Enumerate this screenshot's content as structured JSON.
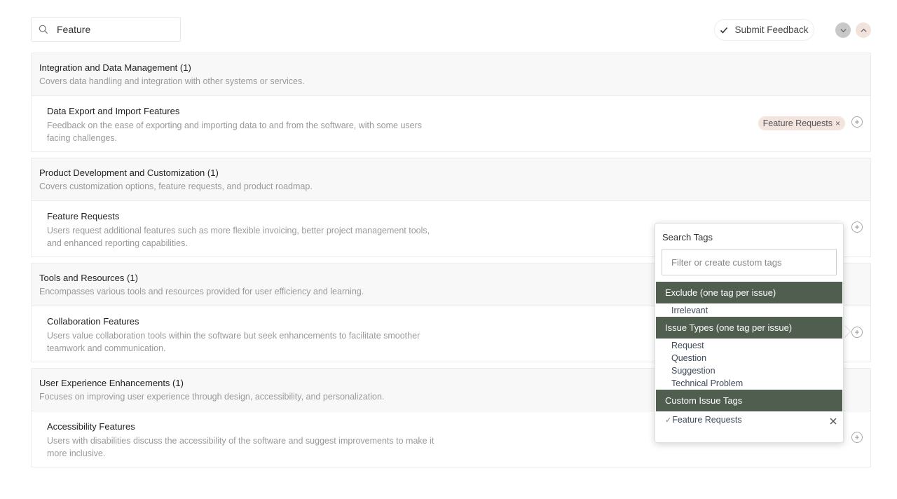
{
  "search": {
    "value": "Feature"
  },
  "toolbar": {
    "submit_label": "Submit Feedback"
  },
  "groups": [
    {
      "title": "Integration and Data Management (1)",
      "description": "Covers data handling and integration with other systems or services.",
      "item": {
        "title": "Data Export and Import Features",
        "description": "Feedback on the ease of exporting and importing data to and from the software, with some users facing challenges.",
        "tag": "Feature Requests"
      }
    },
    {
      "title": "Product Development and Customization (1)",
      "description": "Covers customization options, feature requests, and product roadmap.",
      "item": {
        "title": "Feature Requests",
        "description": "Users request additional features such as more flexible invoicing, better project management tools, and enhanced reporting capabilities."
      }
    },
    {
      "title": "Tools and Resources (1)",
      "description": "Encompasses various tools and resources provided for user efficiency and learning.",
      "item": {
        "title": "Collaboration Features",
        "description": "Users value collaboration tools within the software but seek enhancements to facilitate smoother teamwork and communication."
      }
    },
    {
      "title": "User Experience Enhancements (1)",
      "description": "Focuses on improving user experience through design, accessibility, and personalization.",
      "item": {
        "title": "Accessibility Features",
        "description": "Users with disabilities discuss the accessibility of the software and suggest improvements to make it more inclusive."
      }
    }
  ],
  "tag_popover": {
    "label": "Search Tags",
    "input_placeholder": "Filter or create custom tags",
    "sections": [
      {
        "title": "Exclude (one tag per issue)",
        "options": [
          "Irrelevant"
        ]
      },
      {
        "title": "Issue Types (one tag per issue)",
        "options": [
          "Request",
          "Question",
          "Suggestion",
          "Technical Problem"
        ]
      },
      {
        "title": "Custom Issue Tags",
        "options": [
          "Feature Requests"
        ]
      }
    ]
  },
  "colors": {
    "section_header": "#505e50",
    "tag_bg": "#f3e4df",
    "option_text": "#3f4a5a"
  },
  "icons": {
    "search": "search-icon",
    "check": "check-icon",
    "chevron_down": "chevron-down-icon",
    "chevron_up": "chevron-up-icon",
    "add": "plus-circle-icon",
    "close": "close-icon"
  }
}
